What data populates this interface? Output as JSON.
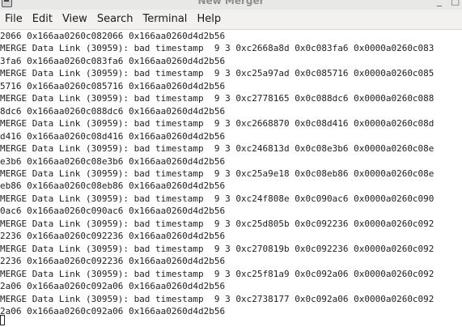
{
  "window": {
    "title": "New Merger",
    "minimize_glyph": "_",
    "maximize_glyph": "□"
  },
  "menu": [
    {
      "label": "File"
    },
    {
      "label": "Edit"
    },
    {
      "label": "View"
    },
    {
      "label": "Search"
    },
    {
      "label": "Terminal"
    },
    {
      "label": "Help"
    }
  ],
  "terminal": {
    "lines": [
      "2066 0x166aa0260c082066 0x166aa0260d4d2b56",
      "MERGE Data Link (30959): bad timestamp  9 3 0xc2668a8d 0x0c083fa6 0x0000a0260c083",
      "3fa6 0x166aa0260c083fa6 0x166aa0260d4d2b56",
      "MERGE Data Link (30959): bad timestamp  9 3 0xc25a97ad 0x0c085716 0x0000a0260c085",
      "5716 0x166aa0260c085716 0x166aa0260d4d2b56",
      "MERGE Data Link (30959): bad timestamp  9 3 0xc2778165 0x0c088dc6 0x0000a0260c088",
      "8dc6 0x166aa0260c088dc6 0x166aa0260d4d2b56",
      "MERGE Data Link (30959): bad timestamp  9 3 0xc2668870 0x0c08d416 0x0000a0260c08d",
      "d416 0x166aa0260c08d416 0x166aa0260d4d2b56",
      "MERGE Data Link (30959): bad timestamp  9 3 0xc246813d 0x0c08e3b6 0x0000a0260c08e",
      "e3b6 0x166aa0260c08e3b6 0x166aa0260d4d2b56",
      "MERGE Data Link (30959): bad timestamp  9 3 0xc25a9e18 0x0c08eb86 0x0000a0260c08e",
      "eb86 0x166aa0260c08eb86 0x166aa0260d4d2b56",
      "MERGE Data Link (30959): bad timestamp  9 3 0xc24f808e 0x0c090ac6 0x0000a0260c090",
      "0ac6 0x166aa0260c090ac6 0x166aa0260d4d2b56",
      "MERGE Data Link (30959): bad timestamp  9 3 0xc25d805b 0x0c092236 0x0000a0260c092",
      "2236 0x166aa0260c092236 0x166aa0260d4d2b56",
      "MERGE Data Link (30959): bad timestamp  9 3 0xc270819b 0x0c092236 0x0000a0260c092",
      "2236 0x166aa0260c092236 0x166aa0260d4d2b56",
      "MERGE Data Link (30959): bad timestamp  9 3 0xc25f81a9 0x0c092a06 0x0000a0260c092",
      "2a06 0x166aa0260c092a06 0x166aa0260d4d2b56",
      "MERGE Data Link (30959): bad timestamp  9 3 0xc2738177 0x0c092a06 0x0000a0260c092",
      "2a06 0x166aa0260c092a06 0x166aa0260d4d2b56"
    ]
  }
}
